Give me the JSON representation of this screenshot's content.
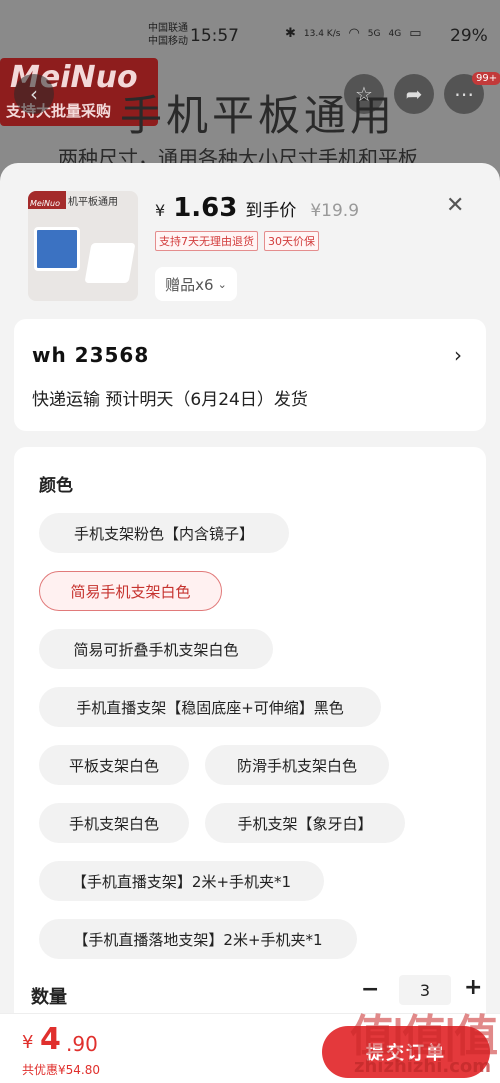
{
  "status_bar": {
    "carrier1": "中国联通",
    "carrier2": "中国移动",
    "time": "15:57",
    "net_speed": "13.4 K/s",
    "signal1": "5G",
    "signal2": "4G",
    "battery": "29%"
  },
  "background": {
    "logo_text": "MeiNuo",
    "logo_sub": "支持大批量采购",
    "banner_title": "手机平板通用",
    "banner_sub": "两种尺寸，通用各种大小尺寸手机和平板",
    "badge": "99+"
  },
  "product": {
    "thumb_logo": "MeiNuo",
    "thumb_title": "机平板通用",
    "price_symbol": "¥",
    "price": "1.63",
    "price_label": "到手价",
    "original_price": "¥19.9",
    "tags": [
      "支持7天无理由退货",
      "30天价保"
    ],
    "gift": "赠品x6"
  },
  "address": {
    "name": "wh  23568",
    "shipping": "快递运输 预计明天（6月24日）发货"
  },
  "options": {
    "section_title": "颜色",
    "chips": [
      "手机支架粉色【内含镜子】",
      "简易手机支架白色",
      "简易可折叠手机支架白色",
      "手机直播支架【稳固底座+可伸缩】黑色",
      "平板支架白色",
      "防滑手机支架白色",
      "手机支架白色",
      "手机支架【象牙白】",
      "【手机直播支架】2米+手机夹*1",
      "【手机直播落地支架】2米+手机夹*1"
    ],
    "selected_index": 1,
    "quantity_label": "数量",
    "quantity": "3",
    "minus": "−",
    "plus": "+"
  },
  "bottom": {
    "total_symbol": "¥",
    "total_int": "4",
    "total_dec": ".90",
    "saving": "共优惠¥54.80",
    "submit": "提交订单",
    "watermark_big": "值|值|值",
    "watermark_small": "zhizhizhi.com"
  },
  "colors": {
    "accent": "#e4393c",
    "selected_border": "#e17a7a"
  }
}
